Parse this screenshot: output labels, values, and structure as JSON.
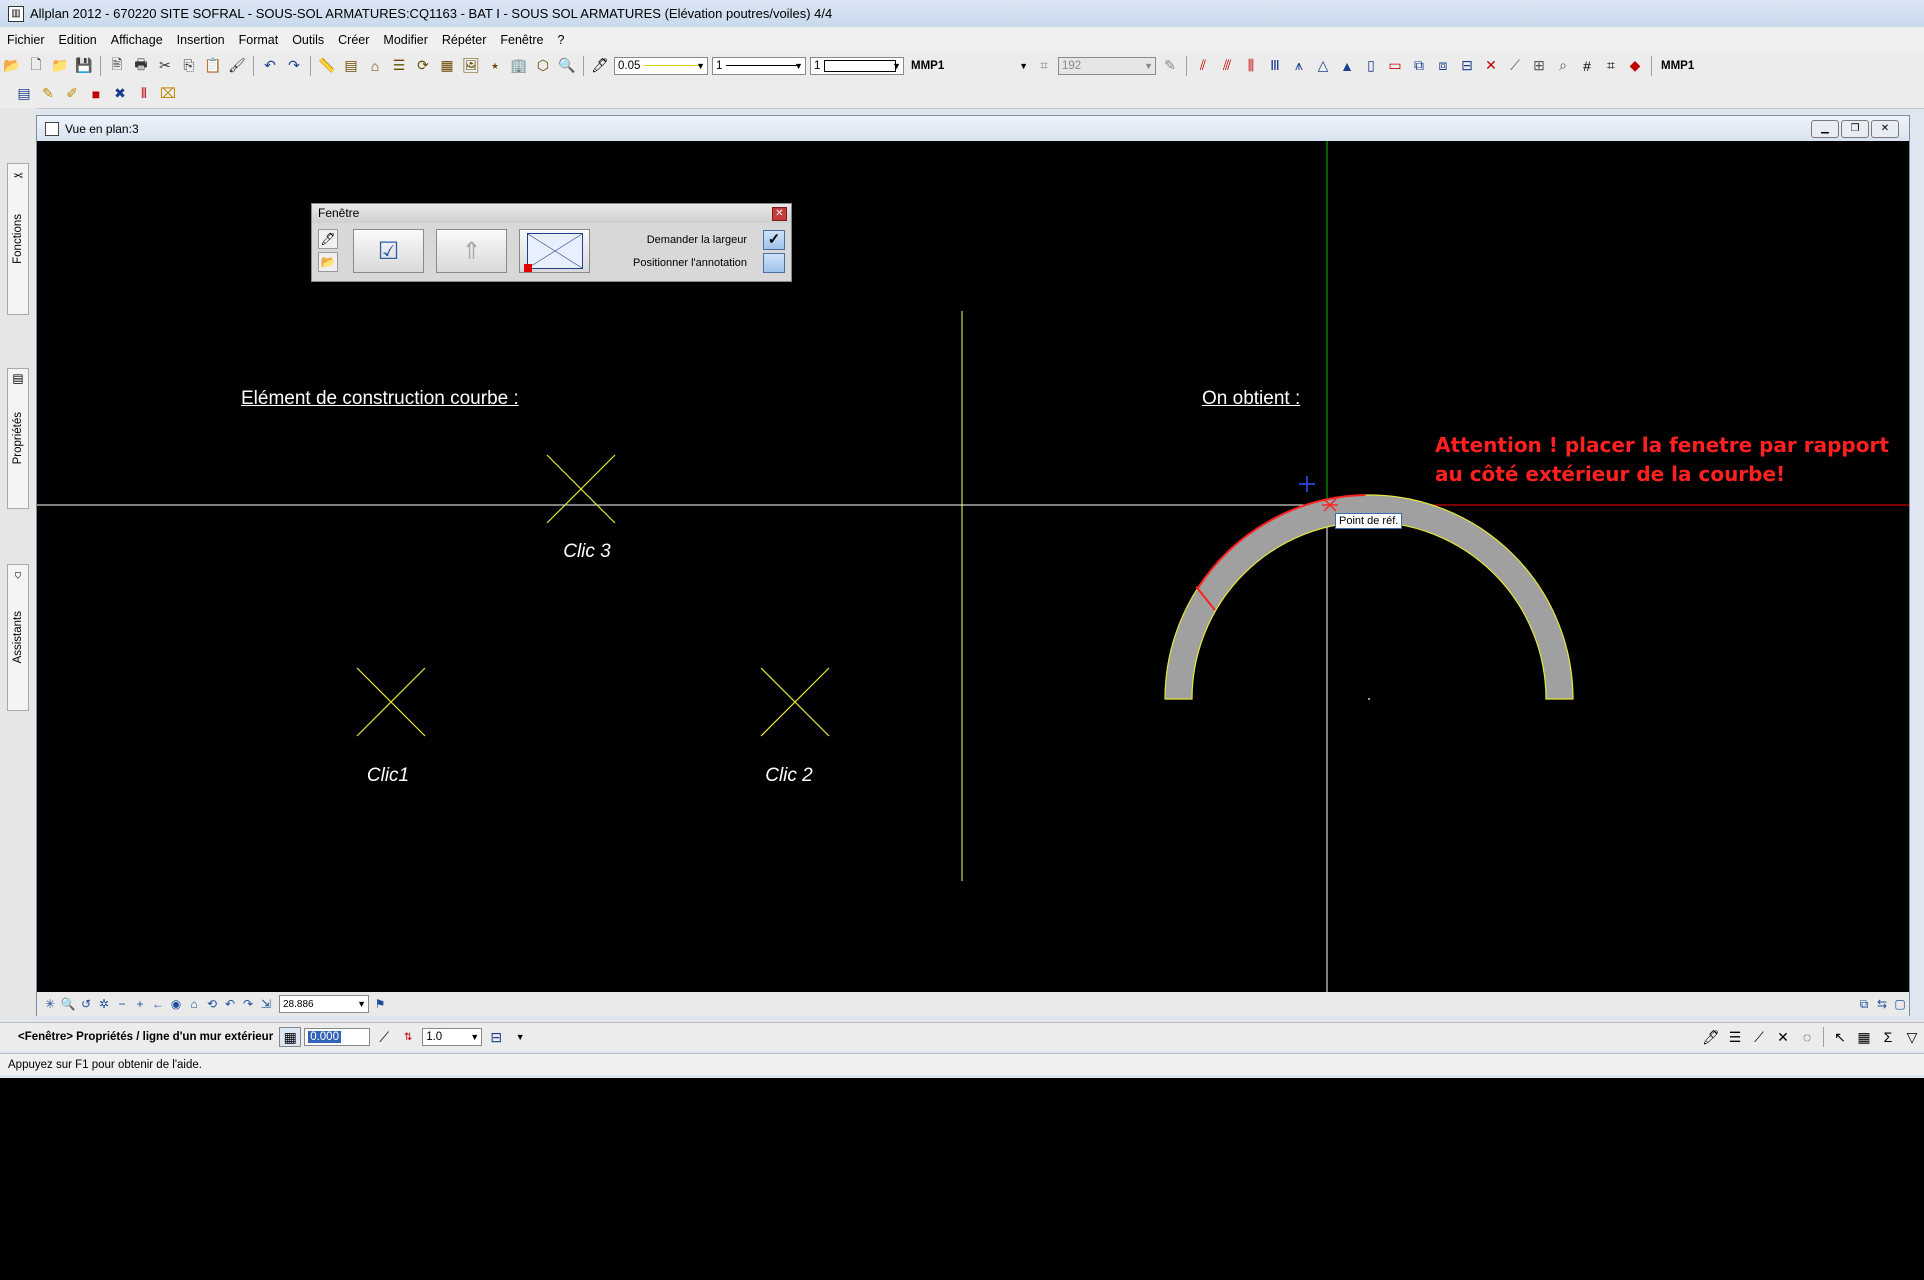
{
  "title": "Allplan 2012 - 670220 SITE SOFRAL - SOUS-SOL ARMATURES:CQ1163 - BAT I - SOUS SOL ARMATURES (Elévation poutres/voiles) 4/4",
  "menu": [
    "Fichier",
    "Edition",
    "Affichage",
    "Insertion",
    "Format",
    "Outils",
    "Créer",
    "Modifier",
    "Répéter",
    "Fenêtre",
    "?"
  ],
  "toolbar1": {
    "file_icons": [
      {
        "name": "open-project-icon",
        "glyph": "📂"
      },
      {
        "name": "new-file-icon",
        "glyph": "🗋"
      },
      {
        "name": "open-file-icon",
        "glyph": "📁"
      },
      {
        "name": "save-icon",
        "glyph": "💾"
      }
    ],
    "edit_icons": [
      {
        "name": "print-preview-icon",
        "glyph": "🖹"
      },
      {
        "name": "print-icon",
        "glyph": "🖶"
      },
      {
        "name": "cut-icon",
        "glyph": "✂"
      },
      {
        "name": "copy-icon",
        "glyph": "⎘"
      },
      {
        "name": "paste-icon",
        "glyph": "📋"
      },
      {
        "name": "format-painter-icon",
        "glyph": "🖌"
      }
    ],
    "undo_icons": [
      {
        "name": "undo-icon",
        "glyph": "↶"
      },
      {
        "name": "redo-icon",
        "glyph": "↷"
      }
    ],
    "view_icons": [
      {
        "name": "measure-icon",
        "glyph": "📏"
      },
      {
        "name": "layer-icon",
        "glyph": "▤"
      },
      {
        "name": "structure-icon",
        "glyph": "⌂"
      },
      {
        "name": "list-icon",
        "glyph": "☰"
      },
      {
        "name": "refresh-icon",
        "glyph": "⟳"
      },
      {
        "name": "fileset-icon",
        "glyph": "▦"
      },
      {
        "name": "image-icon",
        "glyph": "🖼"
      },
      {
        "name": "folder-star-icon",
        "glyph": "⭑"
      },
      {
        "name": "building-icon",
        "glyph": "🏢"
      },
      {
        "name": "cube-icon",
        "glyph": "⬡"
      },
      {
        "name": "help-icon",
        "glyph": "🔍"
      }
    ],
    "pen": {
      "thickness": "0.05",
      "line": "1",
      "color": "1",
      "layer": "MMP1",
      "pattern": "192"
    },
    "draw_icons": [
      {
        "name": "wall-icon",
        "glyph": "⫽",
        "color": "#c00000"
      },
      {
        "name": "wall-line-icon",
        "glyph": "⫻",
        "color": "#c00000"
      },
      {
        "name": "column-icon",
        "glyph": "⫼",
        "color": "#c00000"
      },
      {
        "name": "beam-icon",
        "glyph": "Ⅲ",
        "color": "#1a3d8f"
      },
      {
        "name": "slab-icon",
        "glyph": "⩚",
        "color": "#1a3d8f"
      },
      {
        "name": "roof-icon",
        "glyph": "△",
        "color": "#1a3d8f"
      },
      {
        "name": "ridge-icon",
        "glyph": "▲",
        "color": "#1a3d8f"
      },
      {
        "name": "door-icon",
        "glyph": "▯",
        "color": "#1a3d8f"
      },
      {
        "name": "window-icon",
        "glyph": "▭",
        "color": "#c00000"
      },
      {
        "name": "opening-icon",
        "glyph": "⧉",
        "color": "#1a3d8f"
      },
      {
        "name": "niche-icon",
        "glyph": "⧈",
        "color": "#1a3d8f"
      },
      {
        "name": "recess-icon",
        "glyph": "⊟",
        "color": "#1a3d8f"
      },
      {
        "name": "delete-icon",
        "glyph": "✕",
        "color": "#c00000"
      },
      {
        "name": "snap-icon",
        "glyph": "⟋",
        "color": "#555555"
      },
      {
        "name": "grid-icon",
        "glyph": "⊞",
        "color": "#555555"
      },
      {
        "name": "zoom-icon",
        "glyph": "⌕",
        "color": "#555555"
      },
      {
        "name": "hash-icon",
        "glyph": "#",
        "color": "#000000"
      },
      {
        "name": "hash-fill-icon",
        "glyph": "⌗",
        "color": "#000000"
      },
      {
        "name": "paint-icon",
        "glyph": "◆",
        "color": "#c00000"
      }
    ],
    "layer_right": "MMP1"
  },
  "toolbar2": [
    {
      "name": "palette-icon",
      "glyph": "▤",
      "color": "#1a3d8f"
    },
    {
      "name": "pencil-icon",
      "glyph": "✎",
      "color": "#c08a00"
    },
    {
      "name": "pencil-box-icon",
      "glyph": "✐",
      "color": "#c08a00"
    },
    {
      "name": "red-cube-icon",
      "glyph": "■",
      "color": "#c00000"
    },
    {
      "name": "magic-icon",
      "glyph": "✖",
      "color": "#1a3d8f"
    },
    {
      "name": "hatch-icon",
      "glyph": "⦀",
      "color": "#c00000"
    },
    {
      "name": "stair-icon",
      "glyph": "⌧",
      "color": "#c08a00"
    }
  ],
  "side_tabs": [
    "Fonctions",
    "Propriétés",
    "Assistants"
  ],
  "view": {
    "title": "Vue en plan:3",
    "zoom": "28.886",
    "nav_icons": [
      "✳",
      "🔍",
      "↺",
      "✲",
      "−",
      "+",
      "←",
      "◉",
      "⌂",
      "⟲",
      "↶",
      "↷",
      "⇲"
    ]
  },
  "palette": {
    "title": "Fenêtre",
    "ask_width_label": "Demander la largeur",
    "ask_width_checked": true,
    "ask_width_mark": "✓",
    "position_label": "Positionner l'annotation",
    "position_checked": false
  },
  "canvas": {
    "left_heading": "Elément de construction courbe :",
    "right_heading": "On obtient :",
    "attention": "Attention ! placer la fenetre par rapport au côté extérieur de la courbe!",
    "clic1": "Clic1",
    "clic2": "Clic 2",
    "clic3": "Clic 3",
    "ref_point": "Point de réf.",
    "colors": {
      "axis": "#ffffff",
      "divider": "#ffff66",
      "cross": "#e6e63c",
      "green_axis": "#00c000",
      "red_axis": "#ff0000",
      "arch_fill": "#a0a0a0",
      "arch_edge": "#e6e63c",
      "arch_red": "#ff2020",
      "blue_cross": "#3050ff"
    }
  },
  "propbar": {
    "label": "<Fenêtre> Propriétés / ligne d'un mur extérieur",
    "value": "0.000",
    "factor": "1.0"
  },
  "status": "Appuyez sur F1 pour obtenir de l'aide."
}
